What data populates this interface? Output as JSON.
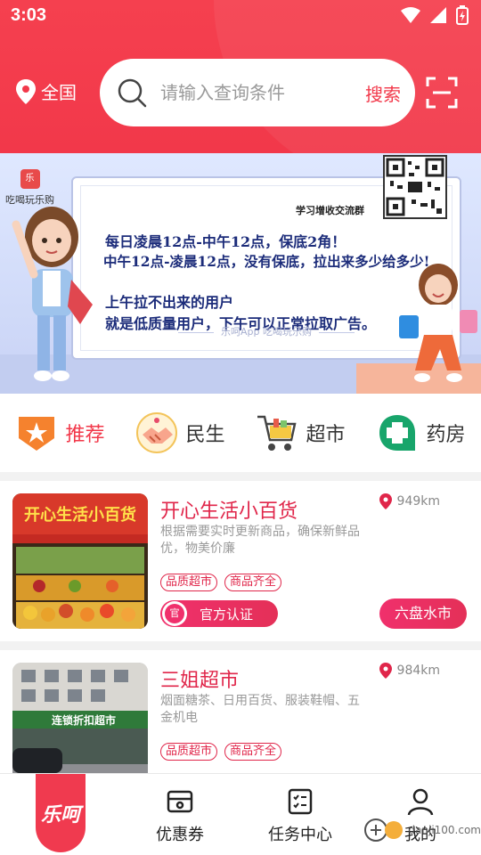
{
  "status_bar": {
    "time": "3:03"
  },
  "header": {
    "location_label": "全国",
    "search": {
      "placeholder": "请输入查询条件",
      "button_label": "搜索"
    }
  },
  "banner": {
    "brand_label": "吃喝玩乐购",
    "tag": "学习增收交流群",
    "lines": [
      "每日凌晨12点-中午12点，保底2角！",
      "中午12点-凌晨12点，没有保底，拉出来多少给多少!",
      "上午拉不出来的用户",
      "就是低质量用户，下午可以正常拉取广告。"
    ],
    "footer": "乐呵App 吃喝玩乐购"
  },
  "categories": [
    {
      "label": "推荐",
      "icon": "shield-star-icon",
      "active": true
    },
    {
      "label": "民生",
      "icon": "handshake-icon",
      "active": false
    },
    {
      "label": "超市",
      "icon": "shopping-cart-icon",
      "active": false
    },
    {
      "label": "药房",
      "icon": "pharmacy-cross-icon",
      "active": false
    }
  ],
  "shops": [
    {
      "name": "开心生活小百货",
      "distance": "949km",
      "desc": "根据需要实时更新商品，确保新鲜品优，物美价廉",
      "tags": [
        "品质超市",
        "商品齐全"
      ],
      "cert_label": "官方认证",
      "cert_badge": "官",
      "area_label": "六盘水市"
    },
    {
      "name": "三姐超市",
      "distance": "984km",
      "desc": "烟面糖茶、日用百货、服装鞋帽、五金机电",
      "tags": [
        "品质超市",
        "商品齐全"
      ]
    }
  ],
  "bottom_nav": {
    "home_label": "乐呵",
    "items": [
      {
        "label": "优惠券",
        "icon": "coupon-icon"
      },
      {
        "label": "任务中心",
        "icon": "task-list-icon"
      },
      {
        "label": "我的",
        "icon": "profile-icon"
      }
    ]
  },
  "watermark": "danji100.com",
  "colors": {
    "brand_red": "#f2384a",
    "accent_pink": "#e0264a"
  }
}
